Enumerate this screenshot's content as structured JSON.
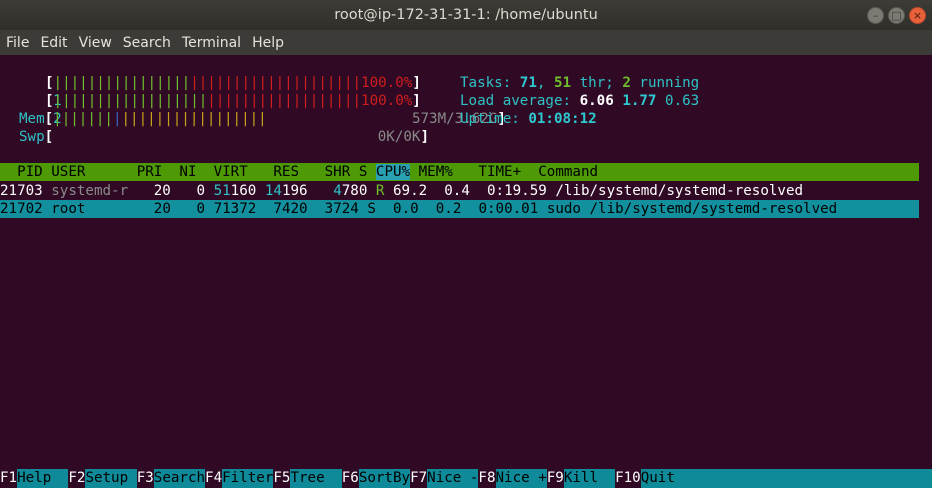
{
  "window": {
    "title": "root@ip-172-31-31-1: /home/ubuntu",
    "controls": [
      "minimize",
      "maximize",
      "close"
    ]
  },
  "menu": [
    "File",
    "Edit",
    "View",
    "Search",
    "Terminal",
    "Help"
  ],
  "meters": {
    "cpu1": {
      "label": "1",
      "value": "100.0%"
    },
    "cpu2": {
      "label": "2",
      "value": "100.0%"
    },
    "mem": {
      "label": "Mem",
      "value": "573M/3.62G"
    },
    "swp": {
      "label": "Swp",
      "value": "0K/0K"
    }
  },
  "stats": {
    "tasks_label": "Tasks: ",
    "tasks": "71",
    "sep1": ", ",
    "threads": "51",
    "thr_label": " thr; ",
    "running": "2",
    "running_label": " running",
    "load_label": "Load average: ",
    "load1": "6.06",
    "load5": "1.77",
    "load15": "0.63",
    "uptime_label": "Uptime: ",
    "uptime": "01:08:12"
  },
  "columns": {
    "pid": "  PID",
    "user": "USER",
    "pri": "PRI",
    "ni": "NI",
    "virt": "VIRT",
    "res": "RES",
    "shr": "SHR",
    "s": "S",
    "cpu": "CPU%",
    "mem": "MEM%",
    "time": "TIME+",
    "command": "Command"
  },
  "processes": [
    {
      "pid": "21703",
      "user": "systemd-r",
      "pri": "20",
      "ni": "0",
      "virt_a": "51",
      "virt_b": "160",
      "res_a": "14",
      "res_b": "196",
      "shr_a": "4",
      "shr_b": "780",
      "s": "R",
      "cpu": "69.2",
      "mem": "0.4",
      "time": "0:19.59",
      "command": "/lib/systemd/systemd-resolved"
    },
    {
      "pid": "21702",
      "user": "root",
      "pri": "20",
      "ni": "0",
      "virt": "71372",
      "res": "7420",
      "shr": "3724",
      "s": "S",
      "cpu": "0.0",
      "mem": "0.2",
      "time": "0:00.01",
      "command": "sudo /lib/systemd/systemd-resolved"
    }
  ],
  "fkeys": [
    {
      "key": "F1",
      "label": "Help  "
    },
    {
      "key": "F2",
      "label": "Setup "
    },
    {
      "key": "F3",
      "label": "Search"
    },
    {
      "key": "F4",
      "label": "Filter"
    },
    {
      "key": "F5",
      "label": "Tree  "
    },
    {
      "key": "F6",
      "label": "SortBy"
    },
    {
      "key": "F7",
      "label": "Nice -"
    },
    {
      "key": "F8",
      "label": "Nice +"
    },
    {
      "key": "F9",
      "label": "Kill  "
    },
    {
      "key": "F10",
      "label": "Quit                                  "
    }
  ],
  "colors": {
    "background": "#300a24",
    "header_bar": "#4e9a06",
    "selection": "#12909e",
    "meter_red": "#d01d1d",
    "meter_green": "#6fbe2c"
  }
}
